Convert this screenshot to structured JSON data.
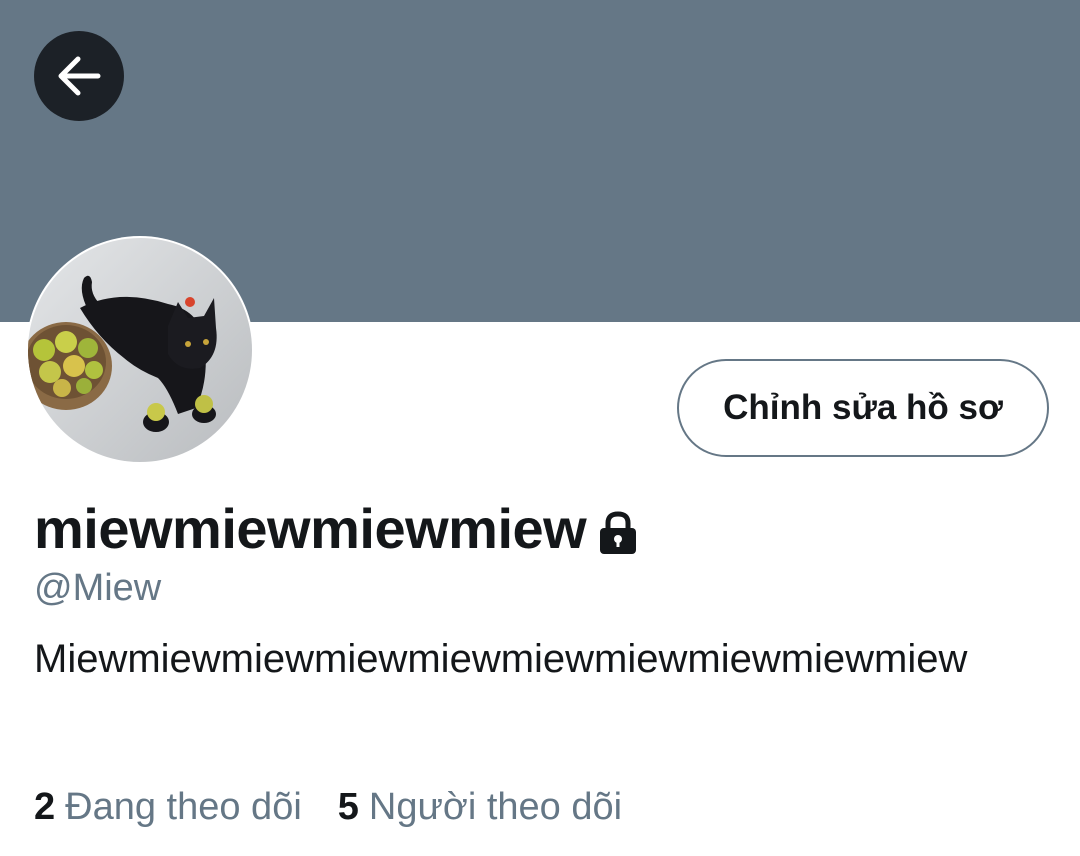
{
  "header": {
    "back_icon": "arrow-left-icon",
    "banner_color": "#657786"
  },
  "profile": {
    "avatar_icon": "cat-photo-avatar",
    "edit_button_label": "Chỉnh sửa hồ sơ",
    "display_name": "miewmiewmiewmiew",
    "lock_icon": "lock-icon",
    "handle": "@Miew",
    "bio": "Miewmiewmiewmiewmiewmiewmiewmiewmiewmiew"
  },
  "stats": {
    "following_count": "2",
    "following_label": "Đang theo dõi",
    "followers_count": "5",
    "followers_label": "Người theo dõi"
  },
  "colors": {
    "text_primary": "#14171a",
    "text_secondary": "#657786",
    "back_button_bg": "#1c2127"
  }
}
